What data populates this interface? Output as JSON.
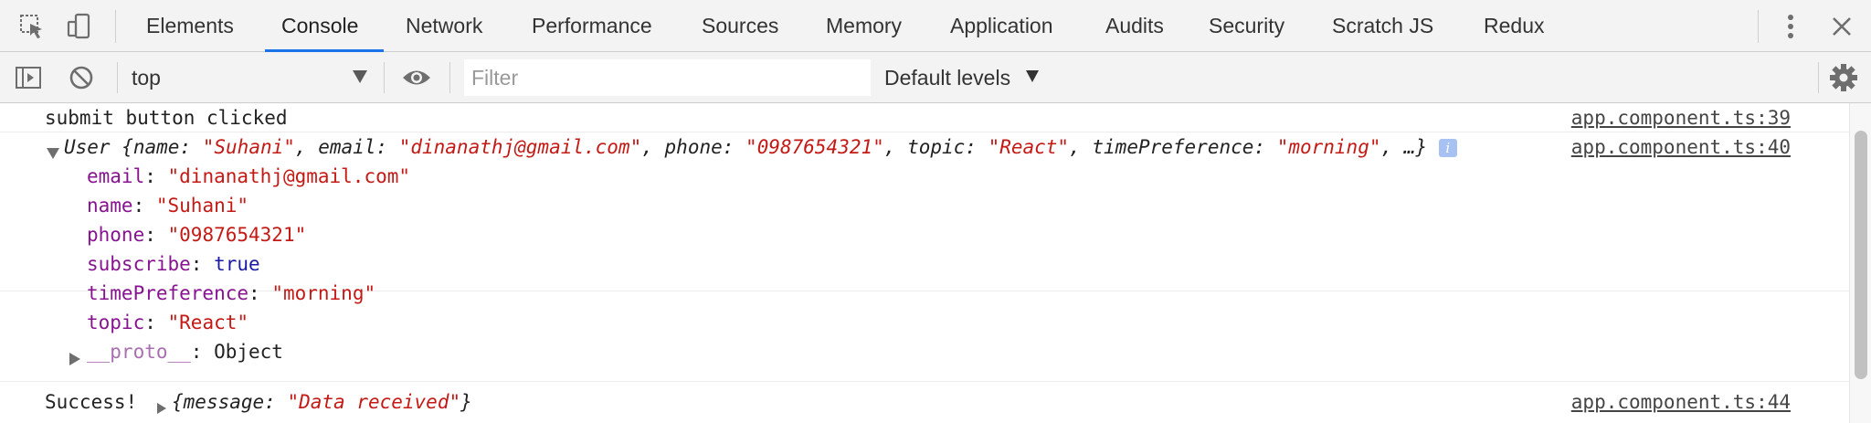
{
  "tabs": [
    {
      "label": "Elements"
    },
    {
      "label": "Console"
    },
    {
      "label": "Network"
    },
    {
      "label": "Performance"
    },
    {
      "label": "Sources"
    },
    {
      "label": "Memory"
    },
    {
      "label": "Application"
    },
    {
      "label": "Audits"
    },
    {
      "label": "Security"
    },
    {
      "label": "Scratch JS"
    },
    {
      "label": "Redux"
    }
  ],
  "active_tab": "Console",
  "toolbar": {
    "context": "top",
    "filter_placeholder": "Filter",
    "levels": "Default levels"
  },
  "messages": {
    "m1": {
      "text": "submit button clicked",
      "source": "app.component.ts:39"
    },
    "m2": {
      "source": "app.component.ts:40",
      "summary": {
        "class": "User",
        "k1": "name",
        "v1": "\"Suhani\"",
        "k2": "email",
        "v2": "\"dinanathj@gmail.com\"",
        "k3": "phone",
        "v3": "\"0987654321\"",
        "k4": "topic",
        "v4": "\"React\"",
        "k5": "timePreference",
        "v5": "\"morning\"",
        "ellipsis": "…}"
      },
      "props": [
        {
          "key": "email",
          "value": "\"dinanathj@gmail.com\""
        },
        {
          "key": "name",
          "value": "\"Suhani\""
        },
        {
          "key": "phone",
          "value": "\"0987654321\""
        },
        {
          "key": "subscribe",
          "value": "true"
        },
        {
          "key": "timePreference",
          "value": "\"morning\""
        },
        {
          "key": "topic",
          "value": "\"React\""
        }
      ],
      "proto_key": "__proto__",
      "proto_value": "Object"
    },
    "m3": {
      "prefix": "Success!",
      "key": "message",
      "value": "\"Data received\"",
      "source": "app.component.ts:44"
    }
  },
  "colors": {
    "accent": "#1a73e8",
    "string": "#c41a16",
    "key": "#881391",
    "boolean": "#1a1aa6"
  }
}
